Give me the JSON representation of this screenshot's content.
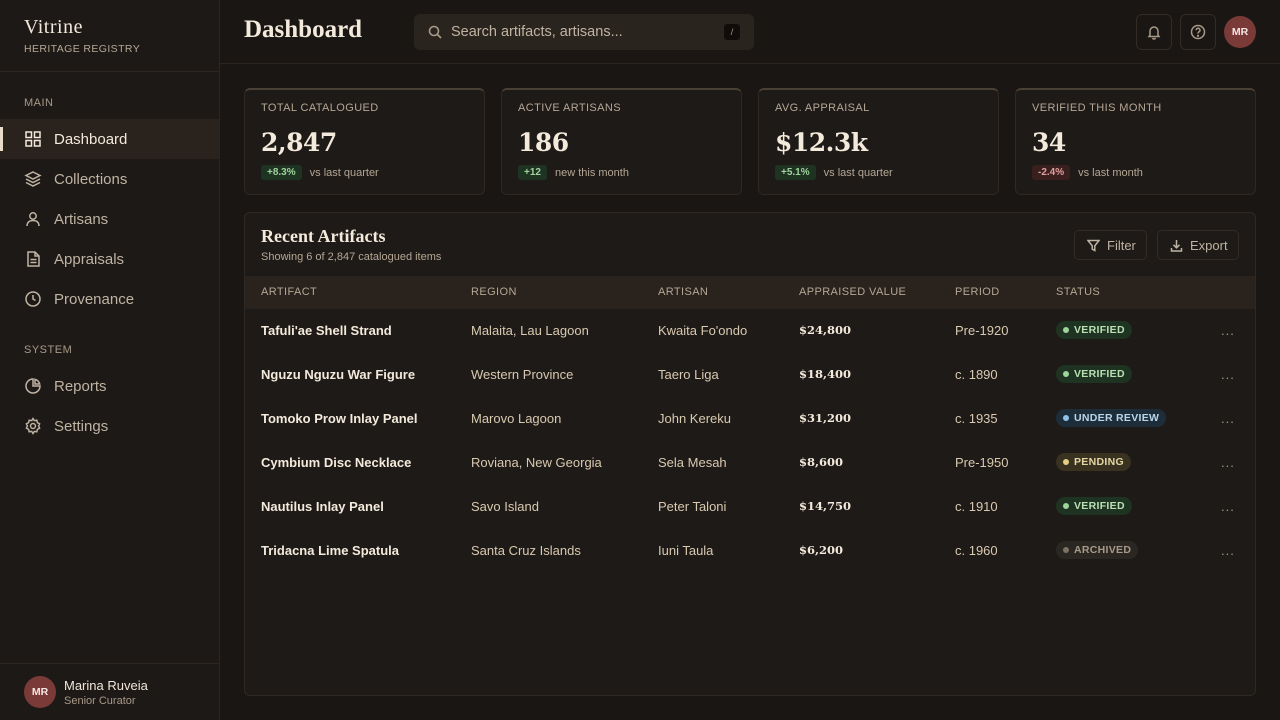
{
  "brand": {
    "title": "Vitrine",
    "subtitle": "HERITAGE REGISTRY"
  },
  "nav": {
    "main_label": "MAIN",
    "system_label": "SYSTEM",
    "main_items": [
      {
        "label": "Dashboard",
        "icon": "grid-icon",
        "active": true
      },
      {
        "label": "Collections",
        "icon": "layers-icon"
      },
      {
        "label": "Artisans",
        "icon": "user-icon"
      },
      {
        "label": "Appraisals",
        "icon": "document-icon"
      },
      {
        "label": "Provenance",
        "icon": "clock-icon"
      }
    ],
    "system_items": [
      {
        "label": "Reports",
        "icon": "pie-chart-icon"
      },
      {
        "label": "Settings",
        "icon": "gear-icon"
      }
    ]
  },
  "user": {
    "initials": "MR",
    "name": "Marina Ruveia",
    "role": "Senior Curator"
  },
  "header": {
    "title": "Dashboard",
    "search_placeholder": "Search artifacts, artisans...",
    "search_shortcut": "/",
    "avatar_initials": "MR"
  },
  "stats": [
    {
      "label": "TOTAL CATALOGUED",
      "value": "2,847",
      "delta": "+8.3%",
      "delta_dir": "up",
      "note": "vs last quarter"
    },
    {
      "label": "ACTIVE ARTISANS",
      "value": "186",
      "delta": "+12",
      "delta_dir": "up",
      "note": "new this month"
    },
    {
      "label": "AVG. APPRAISAL",
      "value": "$12.3k",
      "delta": "+5.1%",
      "delta_dir": "up",
      "note": "vs last quarter"
    },
    {
      "label": "VERIFIED THIS MONTH",
      "value": "34",
      "delta": "-2.4%",
      "delta_dir": "down",
      "note": "vs last month"
    }
  ],
  "table": {
    "title": "Recent Artifacts",
    "subtitle": "Showing 6 of 2,847 catalogued items",
    "filter_label": "Filter",
    "export_label": "Export",
    "columns": [
      "ARTIFACT",
      "REGION",
      "ARTISAN",
      "APPRAISED VALUE",
      "PERIOD",
      "STATUS"
    ],
    "rows": [
      {
        "artifact": "Tafuli'ae Shell Strand",
        "region": "Malaita, Lau Lagoon",
        "artisan": "Kwaita Fo'ondo",
        "value": "$24,800",
        "period": "Pre-1920",
        "status": "VERIFIED"
      },
      {
        "artifact": "Nguzu Nguzu War Figure",
        "region": "Western Province",
        "artisan": "Taero Liga",
        "value": "$18,400",
        "period": "c. 1890",
        "status": "VERIFIED"
      },
      {
        "artifact": "Tomoko Prow Inlay Panel",
        "region": "Marovo Lagoon",
        "artisan": "John Kereku",
        "value": "$31,200",
        "period": "c. 1935",
        "status": "UNDER REVIEW"
      },
      {
        "artifact": "Cymbium Disc Necklace",
        "region": "Roviana, New Georgia",
        "artisan": "Sela Mesah",
        "value": "$8,600",
        "period": "Pre-1950",
        "status": "PENDING"
      },
      {
        "artifact": "Nautilus Inlay Panel",
        "region": "Savo Island",
        "artisan": "Peter Taloni",
        "value": "$14,750",
        "period": "c. 1910",
        "status": "VERIFIED"
      },
      {
        "artifact": "Tridacna Lime Spatula",
        "region": "Santa Cruz Islands",
        "artisan": "Iuni Taula",
        "value": "$6,200",
        "period": "c. 1960",
        "status": "ARCHIVED"
      }
    ],
    "row_menu": "..."
  }
}
